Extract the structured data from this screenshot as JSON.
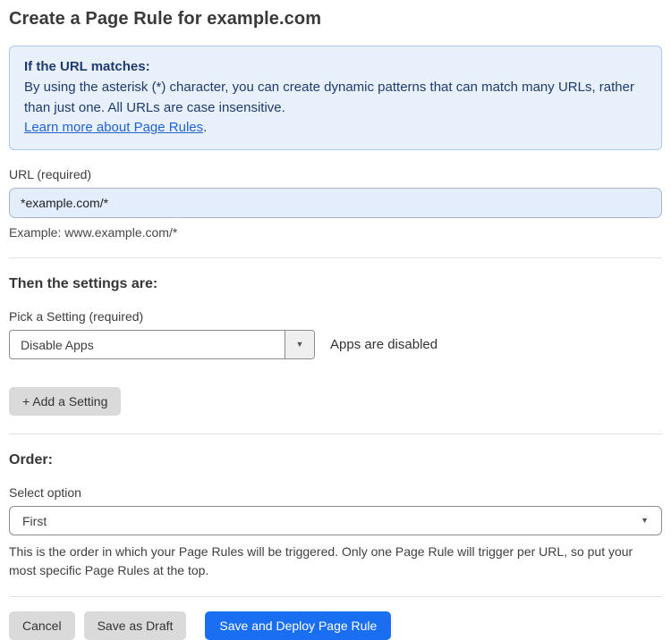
{
  "page": {
    "title": "Create a Page Rule for example.com"
  },
  "info_box": {
    "heading": "If the URL matches:",
    "body": "By using the asterisk (*) character, you can create dynamic patterns that can match many URLs, rather than just one. All URLs are case insensitive.",
    "link_text": "Learn more about Page Rules",
    "link_suffix": "."
  },
  "url_field": {
    "label": "URL (required)",
    "value": "*example.com/*",
    "helper": "Example: www.example.com/*"
  },
  "settings_section": {
    "heading": "Then the settings are:",
    "setting_label": "Pick a Setting (required)",
    "setting_value": "Disable Apps",
    "setting_status": "Apps are disabled",
    "add_setting_label": "+ Add a Setting",
    "caret": "▼"
  },
  "order_section": {
    "heading": "Order:",
    "label": "Select option",
    "value": "First",
    "caret": "▼",
    "helper": "This is the order in which your Page Rules will be triggered. Only one Page Rule will trigger per URL, so put your most specific Page Rules at the top."
  },
  "footer": {
    "cancel_label": "Cancel",
    "save_draft_label": "Save as Draft",
    "save_deploy_label": "Save and Deploy Page Rule"
  },
  "colors": {
    "accent_blue": "#1a6ef2",
    "info_bg": "#e8f1fb",
    "info_border": "#a9c9ee",
    "info_text": "#1f3a6e",
    "link_blue": "#2263d1",
    "input_bg": "#e3edfb",
    "button_gray": "#dadada"
  }
}
